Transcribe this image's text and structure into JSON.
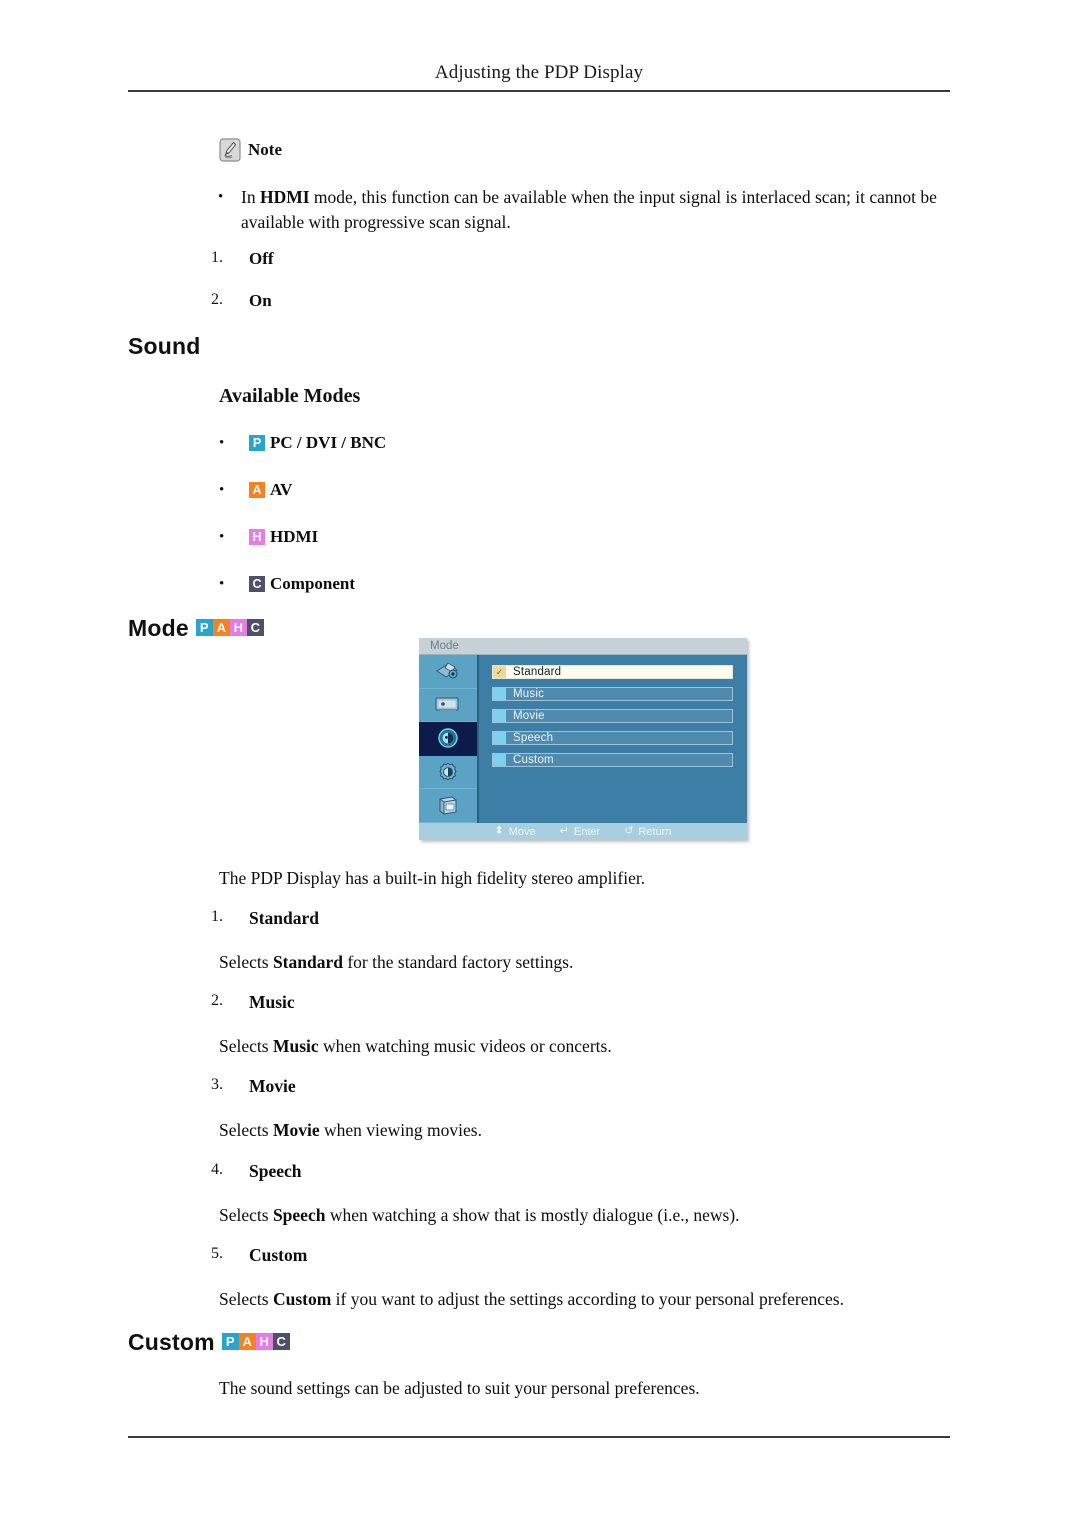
{
  "header": {
    "title": "Adjusting the PDP Display"
  },
  "note": {
    "icon": "note-pen-icon",
    "label": "Note",
    "bullet_marker": "•",
    "bullet_text_pre": "In ",
    "bullet_text_bold": "HDMI",
    "bullet_text_post": " mode, this function can be available when the input signal is interlaced scan; it cannot be available with progressive scan signal.",
    "items": [
      {
        "num": "1.",
        "label": "Off"
      },
      {
        "num": "2.",
        "label": "On"
      }
    ]
  },
  "sound_section": {
    "title": "Sound",
    "available_modes_title": "Available Modes",
    "bullet_marker": "•",
    "modes": [
      {
        "chip": "P",
        "chip_color": "#29a4cc",
        "label": "PC / DVI / BNC"
      },
      {
        "chip": "A",
        "chip_color": "#f6821f",
        "label": "AV"
      },
      {
        "chip": "H",
        "chip_color": "#e67de6",
        "label": "HDMI"
      },
      {
        "chip": "C",
        "chip_color": "#4d5068",
        "label": "Component"
      }
    ]
  },
  "mode_section": {
    "title": "Mode",
    "chips": [
      {
        "letter": "P",
        "color": "#29a4cc"
      },
      {
        "letter": "A",
        "color": "#f6821f"
      },
      {
        "letter": "H",
        "color": "#e67de6"
      },
      {
        "letter": "C",
        "color": "#4d5068"
      }
    ],
    "osd": {
      "window_title": "Mode",
      "sidebar_icons": [
        "picture-brush-icon",
        "screen-adjust-icon",
        "sound-speaker-icon",
        "setup-gear-icon",
        "multi-control-icon"
      ],
      "active_sidebar_index": 2,
      "rows": [
        {
          "label": "Standard",
          "selected": true,
          "marker": "✓"
        },
        {
          "label": "Music",
          "selected": false,
          "marker": ""
        },
        {
          "label": "Movie",
          "selected": false,
          "marker": ""
        },
        {
          "label": "Speech",
          "selected": false,
          "marker": ""
        },
        {
          "label": "Custom",
          "selected": false,
          "marker": ""
        }
      ],
      "footer": [
        {
          "glyph": "⬍",
          "label": "Move"
        },
        {
          "glyph": "↵",
          "label": "Enter"
        },
        {
          "glyph": "↺",
          "label": "Return"
        }
      ]
    },
    "intro": "The PDP Display has a built-in high fidelity stereo amplifier.",
    "items": [
      {
        "num": "1.",
        "heading": "Standard",
        "desc_pre": "Selects ",
        "desc_bold": "Standard",
        "desc_post": " for the standard factory settings."
      },
      {
        "num": "2.",
        "heading": "Music",
        "desc_pre": "Selects ",
        "desc_bold": "Music",
        "desc_post": " when watching music videos or concerts."
      },
      {
        "num": "3.",
        "heading": "Movie",
        "desc_pre": "Selects ",
        "desc_bold": "Movie",
        "desc_post": " when viewing movies."
      },
      {
        "num": "4.",
        "heading": "Speech",
        "desc_pre": "Selects ",
        "desc_bold": "Speech",
        "desc_post": " when watching a show that is mostly dialogue (i.e., news)."
      },
      {
        "num": "5.",
        "heading": "Custom",
        "desc_pre": "Selects ",
        "desc_bold": "Custom",
        "desc_post": " if you want to adjust the settings according to your personal preferences."
      }
    ]
  },
  "custom_section": {
    "title": "Custom",
    "chips": [
      {
        "letter": "P",
        "color": "#29a4cc"
      },
      {
        "letter": "A",
        "color": "#f6821f"
      },
      {
        "letter": "H",
        "color": "#e67de6"
      },
      {
        "letter": "C",
        "color": "#4d5068"
      }
    ],
    "paragraph": "The sound settings can be adjusted to suit your personal preferences."
  }
}
